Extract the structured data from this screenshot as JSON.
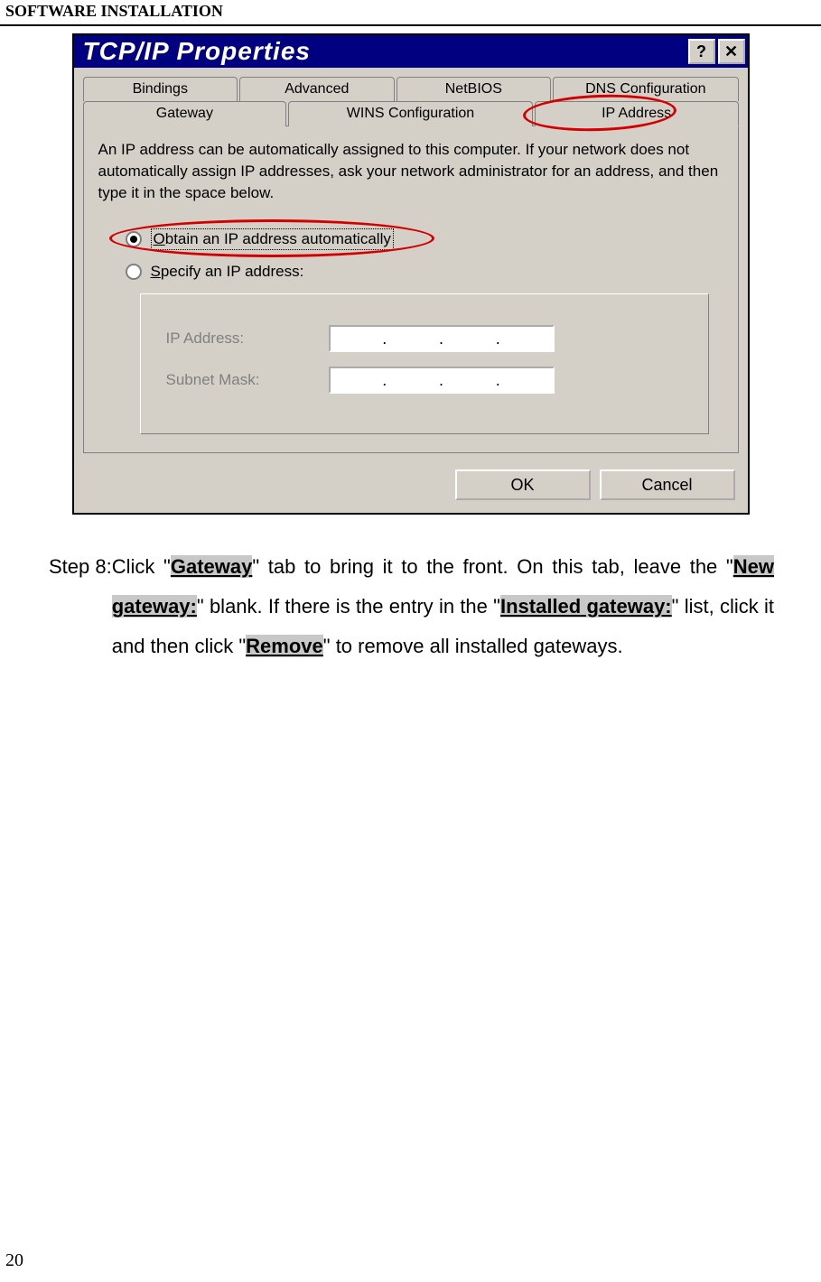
{
  "header": {
    "title": "SOFTWARE INSTALLATION"
  },
  "dialog": {
    "title": "TCP/IP Properties",
    "help_btn": "?",
    "close_btn": "✕",
    "tabs_row1": {
      "bindings": "Bindings",
      "advanced": "Advanced",
      "netbios": "NetBIOS",
      "dns": "DNS Configuration"
    },
    "tabs_row2": {
      "gateway": "Gateway",
      "wins": "WINS Configuration",
      "ipaddress": "IP Address"
    },
    "description": "An IP address can be automatically assigned to this computer. If your network does not automatically assign IP addresses, ask your network administrator for an address, and then type it in the space below.",
    "radio_auto_prefix": "O",
    "radio_auto_rest": "btain an IP address automatically",
    "radio_specify_prefix": "S",
    "radio_specify_rest": "pecify an IP address:",
    "label_ip": "IP Address:",
    "label_subnet": "Subnet Mask:",
    "ok": "OK",
    "cancel": "Cancel"
  },
  "step": {
    "label": "Step 8:",
    "t1": "Click \"",
    "hw1": "Gateway",
    "t2": "\" tab to bring it to the front. On this tab, leave the \"",
    "hw2": "New gateway:",
    "t3": "\" blank. If there is the entry in the \"",
    "hw3": "Installed gateway:",
    "t4": "\" list, click it and then click \"",
    "hw4": "Remove",
    "t5": "\" to remove all installed gateways."
  },
  "page_number": "20"
}
